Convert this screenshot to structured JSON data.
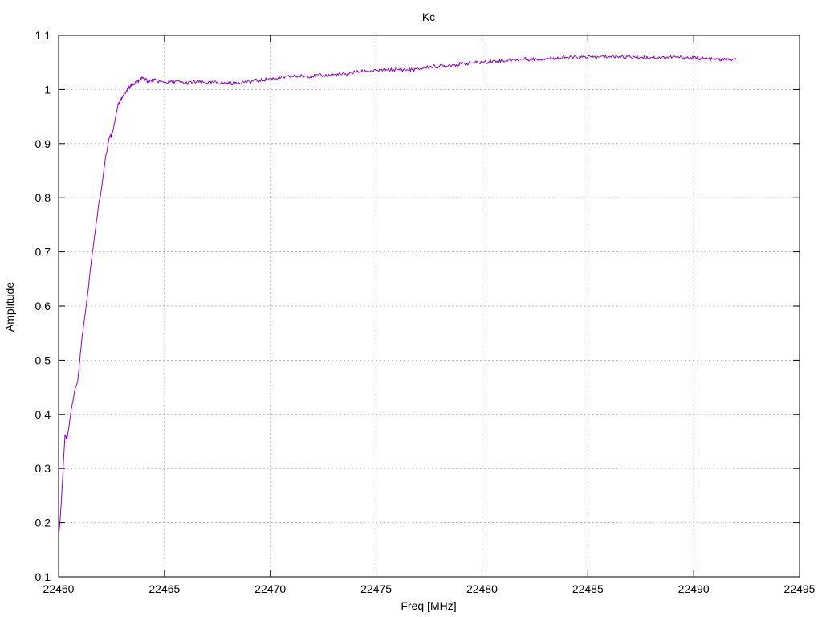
{
  "chart_data": {
    "type": "line",
    "title": "Kc",
    "xlabel": "Freq [MHz]",
    "ylabel": "Amplitude",
    "xlim": [
      22460,
      22495
    ],
    "ylim": [
      0.1,
      1.1
    ],
    "xticks": [
      22460,
      22465,
      22470,
      22475,
      22480,
      22485,
      22490,
      22495
    ],
    "yticks": [
      "0.1",
      "0.2",
      "0.3",
      "0.4",
      "0.5",
      "0.6",
      "0.7",
      "0.8",
      "0.9",
      "1",
      "1.1"
    ],
    "grid": true,
    "legend": "none",
    "series": [
      {
        "color": "#9400d3",
        "points": [
          [
            22460.0,
            0.17
          ],
          [
            22460.1,
            0.22
          ],
          [
            22460.2,
            0.29
          ],
          [
            22460.3,
            0.36
          ],
          [
            22460.4,
            0.355
          ],
          [
            22460.5,
            0.38
          ],
          [
            22460.6,
            0.41
          ],
          [
            22460.7,
            0.43
          ],
          [
            22460.8,
            0.45
          ],
          [
            22460.9,
            0.46
          ],
          [
            22461.0,
            0.5
          ],
          [
            22461.1,
            0.54
          ],
          [
            22461.2,
            0.57
          ],
          [
            22461.3,
            0.6
          ],
          [
            22461.4,
            0.63
          ],
          [
            22461.5,
            0.67
          ],
          [
            22461.6,
            0.7
          ],
          [
            22461.7,
            0.73
          ],
          [
            22461.8,
            0.76
          ],
          [
            22461.9,
            0.79
          ],
          [
            22462.0,
            0.81
          ],
          [
            22462.1,
            0.84
          ],
          [
            22462.2,
            0.87
          ],
          [
            22462.3,
            0.89
          ],
          [
            22462.4,
            0.912
          ],
          [
            22462.5,
            0.915
          ],
          [
            22462.6,
            0.93
          ],
          [
            22462.7,
            0.95
          ],
          [
            22462.8,
            0.97
          ],
          [
            22462.9,
            0.978
          ],
          [
            22463.0,
            0.985
          ],
          [
            22463.2,
            0.997
          ],
          [
            22463.4,
            1.007
          ],
          [
            22463.6,
            1.012
          ],
          [
            22463.8,
            1.017
          ],
          [
            22464.0,
            1.022
          ],
          [
            22464.2,
            1.015
          ],
          [
            22464.5,
            1.017
          ],
          [
            22465.0,
            1.013
          ],
          [
            22465.5,
            1.015
          ],
          [
            22466.0,
            1.012
          ],
          [
            22466.5,
            1.014
          ],
          [
            22467.0,
            1.012
          ],
          [
            22467.5,
            1.013
          ],
          [
            22468.0,
            1.011
          ],
          [
            22468.5,
            1.013
          ],
          [
            22469.0,
            1.015
          ],
          [
            22469.5,
            1.017
          ],
          [
            22470.0,
            1.02
          ],
          [
            22470.5,
            1.022
          ],
          [
            22471.0,
            1.024
          ],
          [
            22471.5,
            1.025
          ],
          [
            22472.0,
            1.025
          ],
          [
            22472.5,
            1.026
          ],
          [
            22473.0,
            1.027
          ],
          [
            22473.5,
            1.028
          ],
          [
            22474.0,
            1.032
          ],
          [
            22474.5,
            1.034
          ],
          [
            22475.0,
            1.035
          ],
          [
            22475.5,
            1.036
          ],
          [
            22476.0,
            1.037
          ],
          [
            22476.5,
            1.036
          ],
          [
            22477.0,
            1.038
          ],
          [
            22477.5,
            1.042
          ],
          [
            22478.0,
            1.043
          ],
          [
            22478.5,
            1.045
          ],
          [
            22479.0,
            1.047
          ],
          [
            22479.5,
            1.049
          ],
          [
            22480.0,
            1.05
          ],
          [
            22480.5,
            1.052
          ],
          [
            22481.0,
            1.053
          ],
          [
            22481.5,
            1.055
          ],
          [
            22482.0,
            1.056
          ],
          [
            22482.5,
            1.056
          ],
          [
            22483.0,
            1.057
          ],
          [
            22483.5,
            1.058
          ],
          [
            22484.0,
            1.059
          ],
          [
            22484.5,
            1.059
          ],
          [
            22485.0,
            1.06
          ],
          [
            22485.5,
            1.06
          ],
          [
            22486.0,
            1.061
          ],
          [
            22486.5,
            1.061
          ],
          [
            22487.0,
            1.06
          ],
          [
            22487.5,
            1.06
          ],
          [
            22488.0,
            1.059
          ],
          [
            22488.5,
            1.059
          ],
          [
            22489.0,
            1.06
          ],
          [
            22489.5,
            1.059
          ],
          [
            22490.0,
            1.058
          ],
          [
            22490.5,
            1.057
          ],
          [
            22491.0,
            1.055
          ],
          [
            22491.5,
            1.055
          ],
          [
            22492.0,
            1.055
          ]
        ]
      }
    ]
  }
}
